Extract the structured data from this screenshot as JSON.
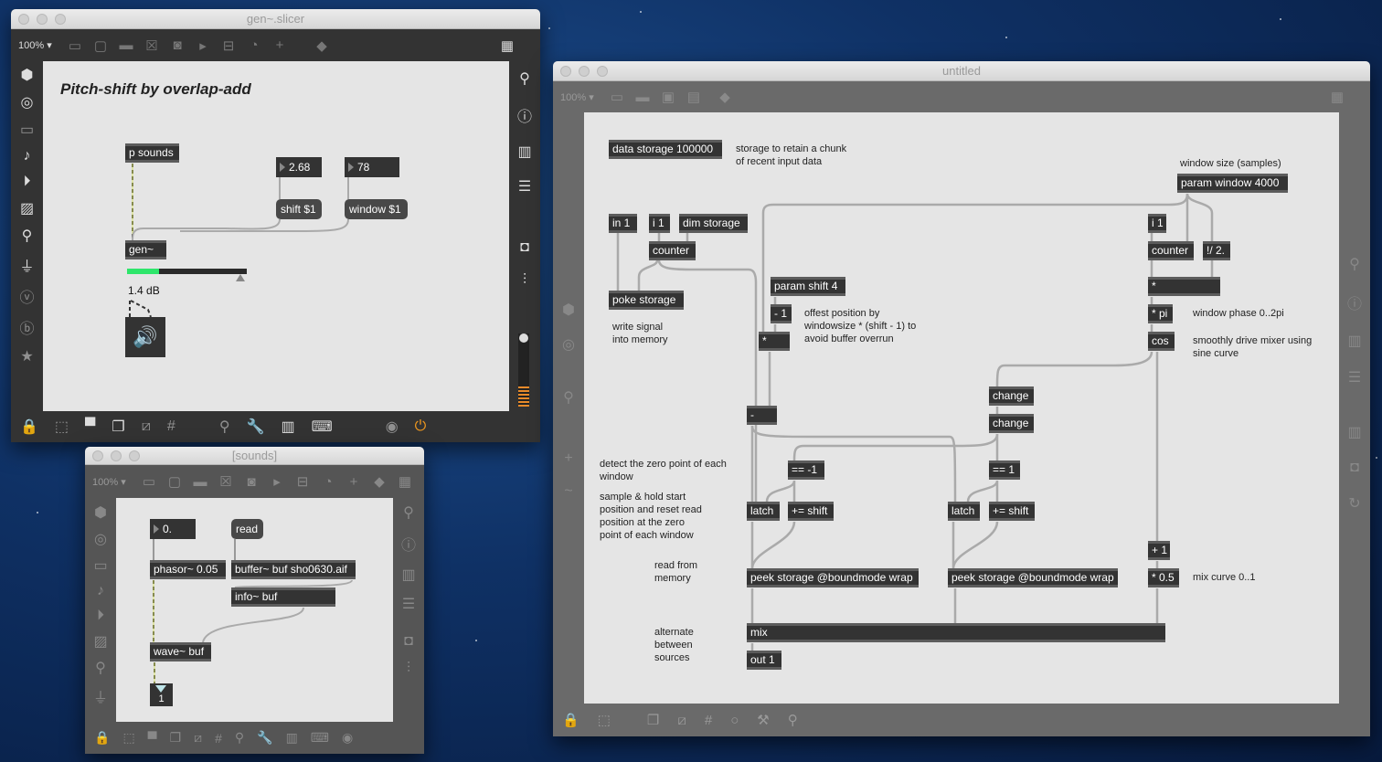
{
  "windows": {
    "slicer": {
      "title": "gen~.slicer",
      "zoom": "100%",
      "patch_title": "Pitch-shift by overlap-add",
      "objects": {
        "p_sounds": "p sounds",
        "gen": "gen~"
      },
      "numbers": {
        "shift": "2.68",
        "window": "78"
      },
      "messages": {
        "shift": "shift $1",
        "window": "window $1"
      },
      "meter": {
        "level": 0.27,
        "readout": "1.4 dB"
      },
      "colors": {
        "meter_green": "#2ee66b"
      }
    },
    "sounds": {
      "title": "[sounds]",
      "zoom": "100%",
      "number": "0.",
      "message_read": "read",
      "objects": {
        "phasor": "phasor~ 0.05",
        "buffer": "buffer~ buf sho0630.aif",
        "info": "info~ buf",
        "wave": "wave~ buf"
      },
      "channel": "1"
    },
    "untitled": {
      "title": "untitled",
      "zoom": "100%",
      "objects": {
        "data_storage": "data storage 100000",
        "in1": "in 1",
        "i1a": "i 1",
        "dim_storage": "dim storage",
        "counter_a": "counter",
        "poke": "poke storage",
        "param_shift": "param shift 4",
        "minus1": "- 1",
        "mul_a": "*",
        "minus": "-",
        "param_window": "param window 4000",
        "i1b": "i 1",
        "counter_b": "counter",
        "rdiv": "!/ 2.",
        "mul_b": "*",
        "mulpi": "* pi",
        "cos": "cos",
        "change1": "change",
        "change2": "change",
        "eqm1": "== -1",
        "eq1": "== 1",
        "latch_a": "latch",
        "pluseq_a": "+= shift",
        "latch_b": "latch",
        "pluseq_b": "+= shift",
        "peek_a": "peek storage @boundmode wrap",
        "peek_b": "peek storage @boundmode wrap",
        "plus1": "+ 1",
        "mul05": "* 0.5",
        "mix": "mix",
        "out1": "out 1"
      },
      "comments": {
        "storage": "storage to retain a chunk\nof recent input data",
        "window_size": "window size (samples)",
        "write": "write signal\ninto memory",
        "offset": "offest position by\nwindowsize * (shift - 1) to\navoid buffer overrun",
        "phase": "window phase 0..2pi",
        "smooth": "smoothly drive mixer using\nsine curve",
        "detect": "detect the zero point of each\nwindow",
        "sample_hold": "sample & hold start\nposition and reset read\nposition at the zero\npoint of each window",
        "read": "read from\nmemory",
        "mix_curve": "mix curve 0..1",
        "alternate": "alternate\nbetween\nsources"
      }
    }
  }
}
